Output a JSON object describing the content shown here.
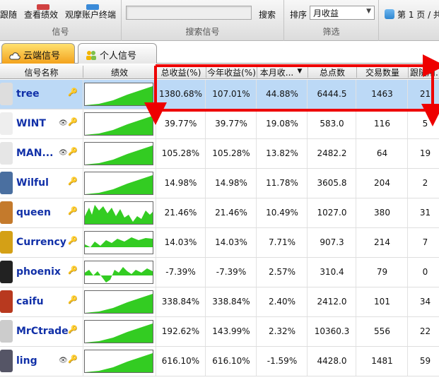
{
  "toolbar": {
    "follow_label": "跟随",
    "view_perf_label": "查看绩效",
    "observe_label": "观摩账户终端",
    "signal_group": "信号",
    "search_button": "搜索",
    "search_group": "搜索信号",
    "sort_label": "排序",
    "sort_value": "月收益",
    "filter_group": "筛选",
    "page_label": "第 1 页 / 共"
  },
  "tabs": [
    {
      "label": "云端信号",
      "active": true
    },
    {
      "label": "个人信号",
      "active": false
    }
  ],
  "table": {
    "headers": [
      "信号名称",
      "绩效",
      "总收益(%)",
      "今年收益(%)",
      "本月收...",
      "总点数",
      "交易数量",
      "跟随用..."
    ],
    "sort_indicator": "▼",
    "rows": [
      {
        "name": "tree",
        "eye": false,
        "perf": "rise",
        "total": "1380.68%",
        "year": "107.01%",
        "month": "44.88%",
        "points": "6444.5",
        "trades": "1463",
        "followers": "21",
        "selected": true
      },
      {
        "name": "WINT",
        "eye": true,
        "perf": "rise",
        "total": "39.77%",
        "year": "39.77%",
        "month": "19.08%",
        "points": "583.0",
        "trades": "116",
        "followers": "5"
      },
      {
        "name": "MAN...",
        "eye": true,
        "perf": "rise",
        "total": "105.28%",
        "year": "105.28%",
        "month": "13.82%",
        "points": "2482.2",
        "trades": "64",
        "followers": "19"
      },
      {
        "name": "Wilful",
        "eye": false,
        "perf": "rise",
        "total": "14.98%",
        "year": "14.98%",
        "month": "11.78%",
        "points": "3605.8",
        "trades": "204",
        "followers": "2"
      },
      {
        "name": "queen",
        "eye": false,
        "perf": "volatile",
        "total": "21.46%",
        "year": "21.46%",
        "month": "10.49%",
        "points": "1027.0",
        "trades": "380",
        "followers": "31"
      },
      {
        "name": "Currency",
        "eye": false,
        "perf": "flat",
        "total": "14.03%",
        "year": "14.03%",
        "month": "7.71%",
        "points": "907.3",
        "trades": "214",
        "followers": "7"
      },
      {
        "name": "phoenix",
        "eye": false,
        "perf": "mixed",
        "total": "-7.39%",
        "year": "-7.39%",
        "month": "2.57%",
        "points": "310.4",
        "trades": "79",
        "followers": "0"
      },
      {
        "name": "caifu",
        "eye": false,
        "perf": "rise",
        "total": "338.84%",
        "year": "338.84%",
        "month": "2.40%",
        "points": "2412.0",
        "trades": "101",
        "followers": "34"
      },
      {
        "name": "MrCtrade",
        "eye": false,
        "perf": "rise",
        "total": "192.62%",
        "year": "143.99%",
        "month": "2.32%",
        "points": "10360.3",
        "trades": "556",
        "followers": "22"
      },
      {
        "name": "ling",
        "eye": true,
        "perf": "rise",
        "total": "616.10%",
        "year": "616.10%",
        "month": "-1.59%",
        "points": "4428.0",
        "trades": "1481",
        "followers": "59"
      }
    ]
  },
  "colors": {
    "chart_fill": "#33cc22",
    "link": "#1130a8",
    "selected_row": "#bcd9f6",
    "annotation": "#ee0000"
  }
}
